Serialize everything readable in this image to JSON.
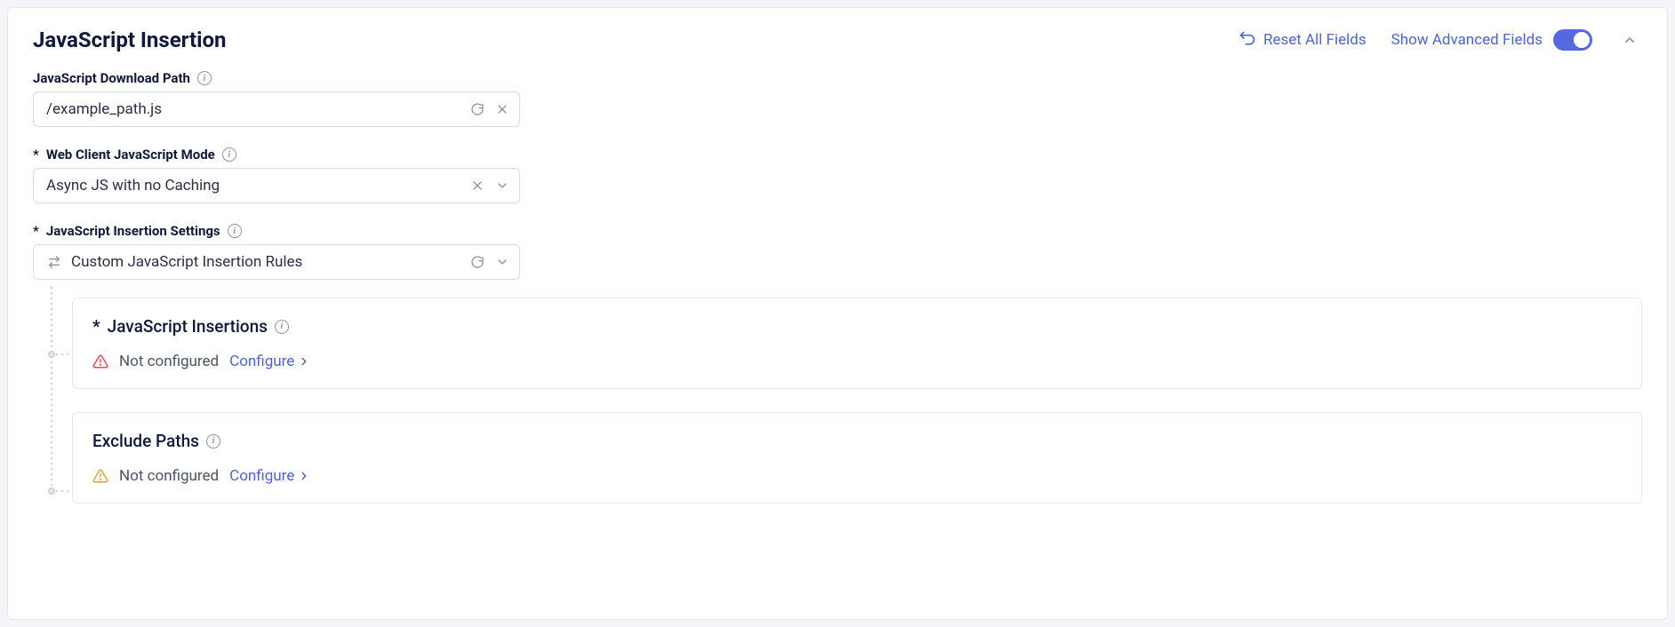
{
  "header": {
    "title": "JavaScript Insertion",
    "reset_label": "Reset All Fields",
    "advanced_label": "Show Advanced Fields",
    "advanced_on": true
  },
  "fields": {
    "download_path": {
      "label": "JavaScript Download Path",
      "value": "/example_path.js"
    },
    "js_mode": {
      "label": "Web Client JavaScript Mode",
      "value": "Async JS with no Caching"
    },
    "insertion_settings": {
      "label": "JavaScript Insertion Settings",
      "value": "Custom JavaScript Insertion Rules"
    }
  },
  "cards": {
    "insertions": {
      "title": "JavaScript Insertions",
      "status": "Not configured",
      "action": "Configure",
      "severity": "error"
    },
    "exclude": {
      "title": "Exclude Paths",
      "status": "Not configured",
      "action": "Configure",
      "severity": "warning"
    }
  }
}
